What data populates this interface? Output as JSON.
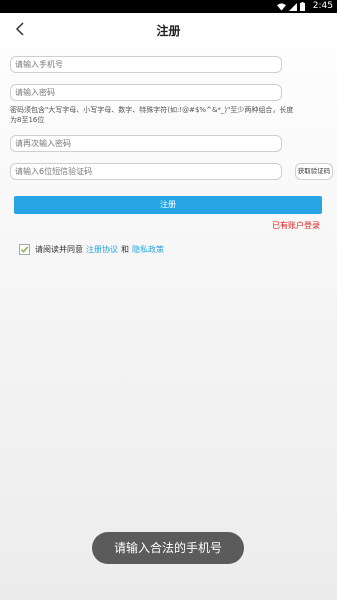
{
  "status_bar": {
    "time": "2:45"
  },
  "header": {
    "title": "注册"
  },
  "form": {
    "phone_placeholder": "请输入手机号",
    "password_placeholder": "请输入密码",
    "password_hint": "密码须包含\"大写字母、小写字母、数字、特殊字符(如:!@#$%^&*_)\"至少两种组合，长度为8至16位",
    "password_confirm_placeholder": "请再次输入密码",
    "code_placeholder": "请输入6位短信验证码",
    "get_code_label": "获取验证码",
    "submit_label": "注册",
    "login_link": "已有账户登录"
  },
  "agreement": {
    "prefix": "请阅读并同意",
    "terms_link": "注册协议",
    "and": "和",
    "privacy_link": "隐私政策",
    "checked": true
  },
  "toast": {
    "message": "请输入合法的手机号"
  },
  "colors": {
    "accent": "#26a4e4",
    "link_red": "#e0201a"
  }
}
